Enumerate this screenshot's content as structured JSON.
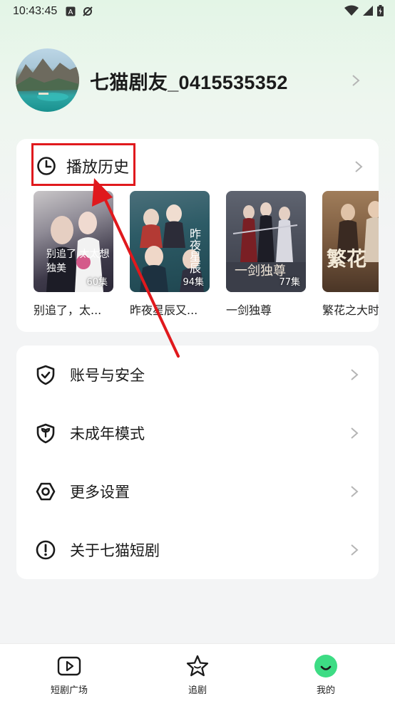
{
  "status_bar": {
    "time": "10:43:45"
  },
  "profile": {
    "username": "七猫剧友_0415535352"
  },
  "history": {
    "title": "播放历史",
    "items": [
      {
        "title": "别追了，太...",
        "episodes": "60集",
        "poster_text": "别追了 太太想独美"
      },
      {
        "title": "昨夜星辰又...",
        "episodes": "94集",
        "poster_text": "昨夜星辰"
      },
      {
        "title": "一剑独尊",
        "episodes": "77集",
        "poster_text": "一剑独尊"
      },
      {
        "title": "繁花之大时",
        "episodes": "6",
        "poster_text": "繁花"
      }
    ]
  },
  "settings": [
    {
      "label": "账号与安全",
      "icon": "shield-icon"
    },
    {
      "label": "未成年模式",
      "icon": "minor-mode-icon"
    },
    {
      "label": "更多设置",
      "icon": "hex-settings-icon"
    },
    {
      "label": "关于七猫短剧",
      "icon": "info-icon"
    }
  ],
  "tabbar": {
    "tabs": [
      {
        "label": "短剧广场",
        "icon": "play-square-icon"
      },
      {
        "label": "追剧",
        "icon": "star-icon"
      },
      {
        "label": "我的",
        "icon": "profile-face-icon"
      }
    ]
  },
  "colors": {
    "accent_green": "#3ddc84",
    "highlight_red": "#e0191d"
  }
}
